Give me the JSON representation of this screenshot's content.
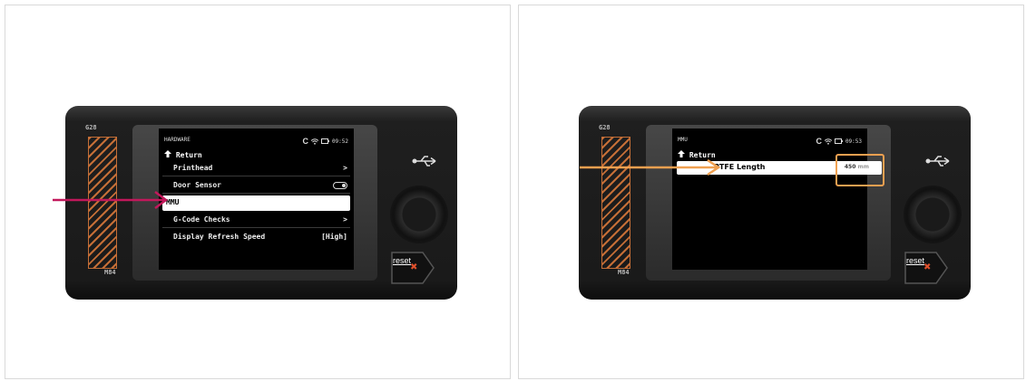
{
  "left_panel": {
    "device": {
      "top_label": "G28",
      "bottom_label": "M84",
      "reset_label": "reset",
      "reset_icon": "x-icon",
      "usb_icon": "usb-icon"
    },
    "screen": {
      "title": "HARDWARE",
      "status": {
        "c": "C",
        "wifi_icon": "wifi-icon",
        "usb_icon": "usb-drive-icon",
        "time": "09:52"
      },
      "return_label": "Return",
      "items": [
        {
          "label": "Printhead",
          "value": ">"
        },
        {
          "label": "Door Sensor",
          "value": "toggle"
        },
        {
          "label": "MMU",
          "value": ""
        },
        {
          "label": "G-Code Checks",
          "value": ">"
        },
        {
          "label": "Display Refresh Speed",
          "value": "[High]"
        }
      ],
      "selected": "MMU"
    },
    "arrow_color": "#c2185b"
  },
  "right_panel": {
    "device": {
      "top_label": "G28",
      "bottom_label": "M84",
      "reset_label": "reset",
      "reset_icon": "x-icon",
      "usb_icon": "usb-icon"
    },
    "screen": {
      "title": "MMU",
      "status": {
        "c": "C",
        "wifi_icon": "wifi-icon",
        "usb_icon": "usb-drive-icon",
        "time": "09:53"
      },
      "return_label": "Return",
      "item": {
        "label": "PTFE Length",
        "value": "450",
        "unit": "mm"
      }
    },
    "arrow_color": "#f0a050"
  }
}
